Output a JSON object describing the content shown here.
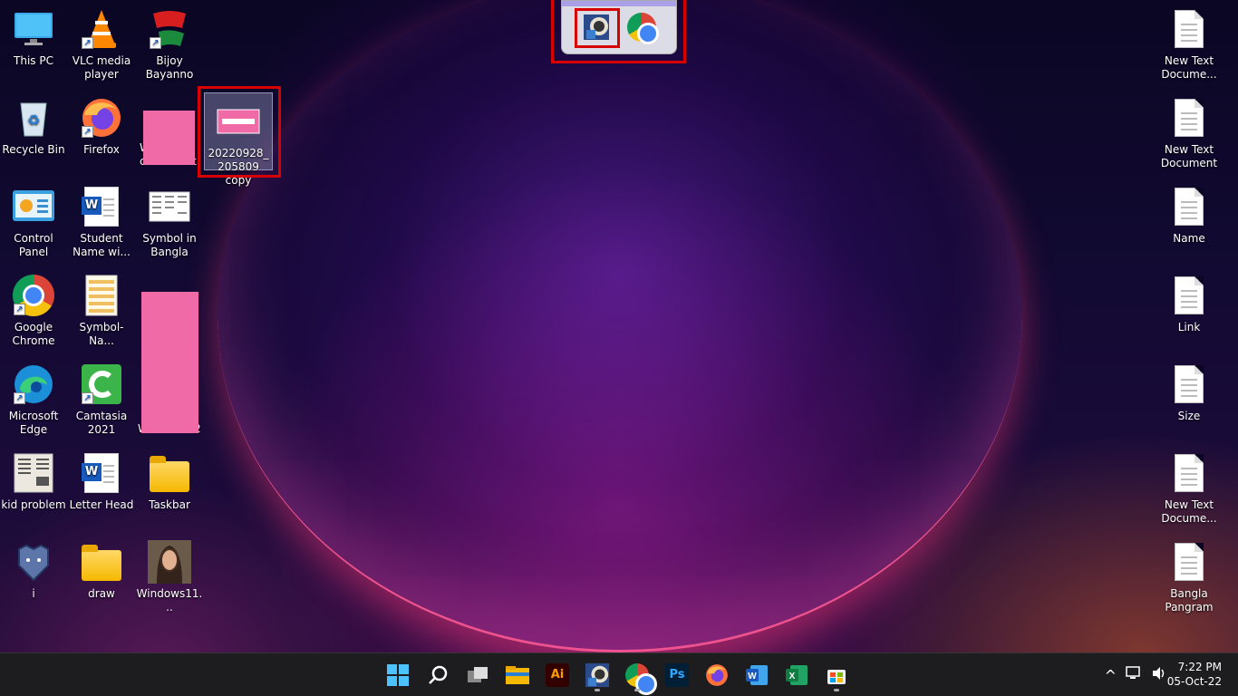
{
  "desktop": {
    "col1": [
      {
        "label": "This PC",
        "icon": "monitor-icon"
      },
      {
        "label": "Recycle Bin",
        "icon": "recycle-bin-icon"
      },
      {
        "label": "Control Panel",
        "icon": "control-panel-icon"
      },
      {
        "label": "Google Chrome",
        "icon": "chrome-icon"
      },
      {
        "label": "Microsoft Edge",
        "icon": "edge-icon"
      },
      {
        "label": "kid problem",
        "icon": "document-image-icon"
      },
      {
        "label": "i",
        "icon": "grizzly-logo-icon"
      }
    ],
    "col2": [
      {
        "label": "VLC media player",
        "icon": "vlc-icon"
      },
      {
        "label": "Firefox",
        "icon": "firefox-icon"
      },
      {
        "label": "Student Name wi...",
        "icon": "word-icon"
      },
      {
        "label": "Symbol-Na...",
        "icon": "document-image-icon"
      },
      {
        "label": "Camtasia 2021",
        "icon": "camtasia-icon"
      },
      {
        "label": "Letter Head",
        "icon": "word-icon"
      },
      {
        "label": "draw",
        "icon": "folder-icon"
      }
    ],
    "col3": [
      {
        "label": "Bijoy Bayanno",
        "icon": "bijoy-icon"
      },
      {
        "label": "Symbol in Bangla",
        "icon": "document-image-icon"
      },
      {
        "label": "Taskbar",
        "icon": "folder-icon"
      },
      {
        "label": "Windows11...",
        "icon": "photo-icon"
      }
    ],
    "col3_partial": [
      "W",
      "r",
      "c",
      "t",
      "W",
      "2"
    ],
    "selected_file": "20220928_205809 copy",
    "right_col": [
      {
        "label": "New Text Docume..."
      },
      {
        "label": "New Text Document"
      },
      {
        "label": "Name"
      },
      {
        "label": "Link"
      },
      {
        "label": "Size"
      },
      {
        "label": "New Text Docume..."
      },
      {
        "label": "Bangla Pangram"
      }
    ]
  },
  "popup": {
    "icons": [
      "app-shortcut-icon",
      "chrome-icon"
    ]
  },
  "taskbar": {
    "apps": [
      "start-icon",
      "search-icon",
      "task-view-icon",
      "file-explorer-icon",
      "illustrator-icon",
      "app-shortcut-icon",
      "chrome-icon",
      "photoshop-icon",
      "firefox-icon",
      "word-icon",
      "excel-icon",
      "store-icon"
    ],
    "illustrator_text": "Ai",
    "photoshop_text": "Ps",
    "time": "7:22 PM",
    "date": "05-Oct-22",
    "tray_chevron": "^"
  },
  "colors": {
    "highlight": "#d90000",
    "redaction": "#f06aa8"
  }
}
